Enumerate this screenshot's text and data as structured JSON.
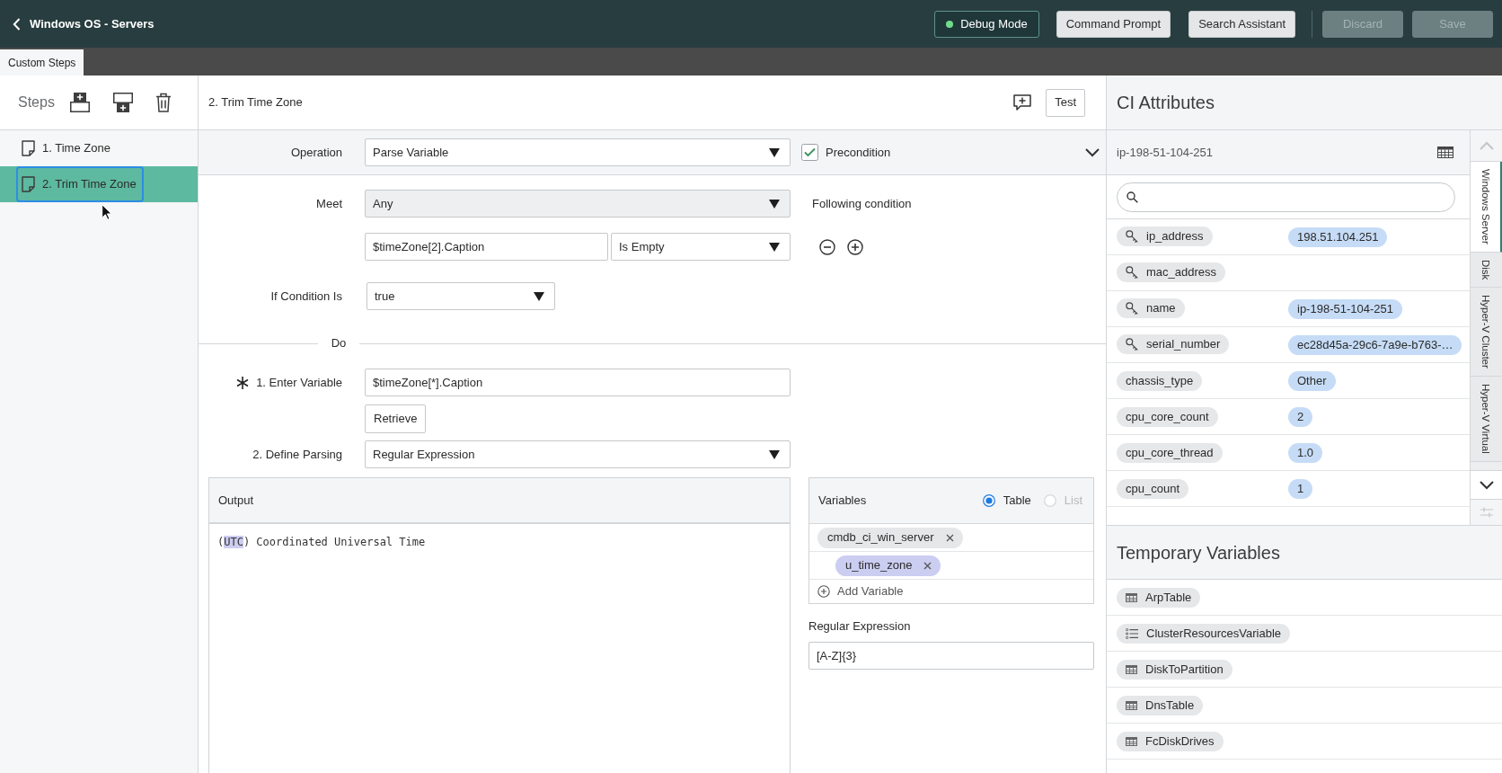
{
  "header": {
    "title": "Windows OS - Servers",
    "debug_mode": {
      "label": "Debug Mode",
      "on": true
    },
    "tools": [
      {
        "label": "Command Prompt",
        "disabled": false
      },
      {
        "label": "Search Assistant",
        "disabled": false
      }
    ],
    "actions": [
      {
        "label": "Discard",
        "disabled": true
      },
      {
        "label": "Save",
        "disabled": true
      }
    ]
  },
  "tabs": [
    {
      "label": "Custom Steps",
      "selected": true
    }
  ],
  "steps_panel": {
    "title": "Steps",
    "steps": [
      {
        "label": "1. Time Zone",
        "selected": false
      },
      {
        "label": "2. Trim Time Zone",
        "selected": true
      }
    ]
  },
  "editor": {
    "title": "2. Trim Time Zone",
    "test_button": "Test",
    "operation": {
      "label": "Operation",
      "value": "Parse Variable"
    },
    "precondition": {
      "label": "Precondition",
      "checked": true
    },
    "meet": {
      "label": "Meet",
      "value": "Any",
      "disabled": true
    },
    "following_condition": "Following condition",
    "condition": {
      "variable": "$timeZone[2].Caption",
      "operator": "Is Empty"
    },
    "if_condition": {
      "label": "If Condition Is",
      "value": "true"
    },
    "do_label": "Do",
    "enter_variable": {
      "label": "1. Enter Variable",
      "required": true,
      "value": "$timeZone[*].Caption"
    },
    "retrieve_button": "Retrieve",
    "define_parsing": {
      "label": "2. Define Parsing",
      "value": "Regular Expression"
    },
    "output": {
      "title": "Output",
      "segments": [
        {
          "text": "(",
          "highlighted": false
        },
        {
          "text": "UTC",
          "highlighted": true
        },
        {
          "text": ") Coordinated Universal Time",
          "highlighted": false
        }
      ]
    },
    "variables": {
      "title": "Variables",
      "views": [
        {
          "label": "Table",
          "selected": true,
          "disabled": false
        },
        {
          "label": "List",
          "selected": false,
          "disabled": true
        }
      ],
      "items": [
        {
          "name": "cmdb_ci_win_server",
          "children": [
            {
              "name": "u_time_zone"
            }
          ]
        }
      ],
      "add_variable": "Add Variable"
    },
    "regular_expression": {
      "label": "Regular Expression",
      "value": "[A-Z]{3}"
    }
  },
  "ci_attributes": {
    "title": "CI Attributes",
    "ci_name": "ip-198-51-104-251",
    "attributes": [
      {
        "name": "ip_address",
        "key": true,
        "value": "198.51.104.251"
      },
      {
        "name": "mac_address",
        "key": true
      },
      {
        "name": "name",
        "key": true,
        "value": "ip-198-51-104-251"
      },
      {
        "name": "serial_number",
        "key": true,
        "value": "ec28d45a-29c6-7a9e-b763-…"
      },
      {
        "name": "chassis_type",
        "key": false,
        "value": "Other"
      },
      {
        "name": "cpu_core_count",
        "key": false,
        "value": "2"
      },
      {
        "name": "cpu_core_thread",
        "key": false,
        "value": "1.0"
      },
      {
        "name": "cpu_count",
        "key": false,
        "value": "1"
      }
    ],
    "tabs": [
      {
        "label": "Windows Server",
        "selected": true
      },
      {
        "label": "Disk",
        "selected": false
      },
      {
        "label": "Hyper-V Cluster",
        "selected": false
      },
      {
        "label": "Hyper-V Virtual",
        "selected": false
      }
    ]
  },
  "temporary_variables": {
    "title": "Temporary Variables",
    "items": [
      {
        "name": "ArpTable",
        "kind": "table"
      },
      {
        "name": "ClusterResourcesVariable",
        "kind": "list"
      },
      {
        "name": "DiskToPartition",
        "kind": "table"
      },
      {
        "name": "DnsTable",
        "kind": "table"
      },
      {
        "name": "FcDiskDrives",
        "kind": "table"
      }
    ]
  }
}
